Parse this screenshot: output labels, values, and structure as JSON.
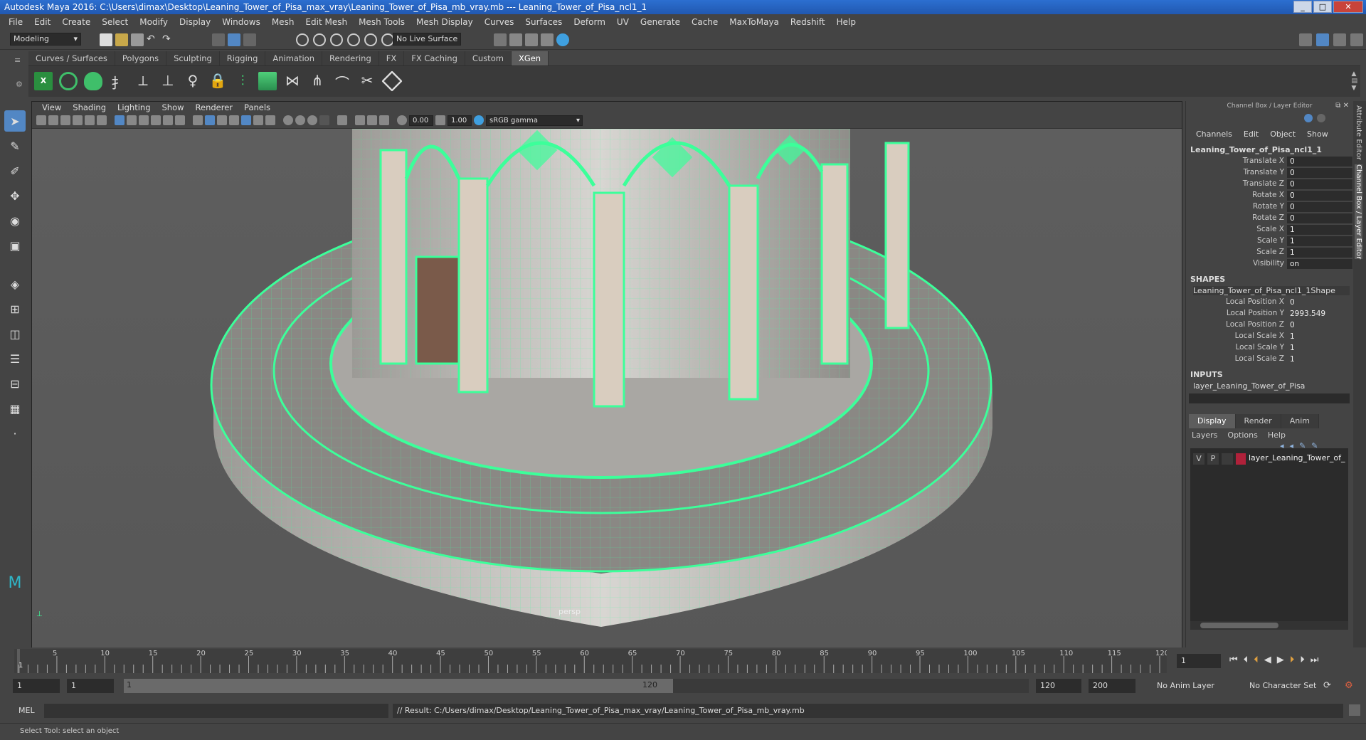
{
  "title": "Autodesk Maya 2016: C:\\Users\\dimax\\Desktop\\Leaning_Tower_of_Pisa_max_vray\\Leaning_Tower_of_Pisa_mb_vray.mb   ---   Leaning_Tower_of_Pisa_ncl1_1",
  "menubar": [
    "File",
    "Edit",
    "Create",
    "Select",
    "Modify",
    "Display",
    "Windows",
    "Mesh",
    "Edit Mesh",
    "Mesh Tools",
    "Mesh Display",
    "Curves",
    "Surfaces",
    "Deform",
    "UV",
    "Generate",
    "Cache",
    "MaxToMaya",
    "Redshift",
    "Help"
  ],
  "status": {
    "menuset": "Modeling",
    "live_surface": "No Live Surface"
  },
  "shelf_tabs": [
    "Curves / Surfaces",
    "Polygons",
    "Sculpting",
    "Rigging",
    "Animation",
    "Rendering",
    "FX",
    "FX Caching",
    "Custom",
    "XGen"
  ],
  "active_shelf": "XGen",
  "viewport": {
    "menu": [
      "View",
      "Shading",
      "Lighting",
      "Show",
      "Renderer",
      "Panels"
    ],
    "exposure": "0.00",
    "gamma": "1.00",
    "color_space": "sRGB gamma",
    "camera_label": "persp"
  },
  "channelbox": {
    "title": "Channel Box / Layer Editor",
    "menu": [
      "Channels",
      "Edit",
      "Object",
      "Show"
    ],
    "object": "Leaning_Tower_of_Pisa_ncl1_1",
    "attrs": [
      {
        "label": "Translate X",
        "value": "0"
      },
      {
        "label": "Translate Y",
        "value": "0"
      },
      {
        "label": "Translate Z",
        "value": "0"
      },
      {
        "label": "Rotate X",
        "value": "0"
      },
      {
        "label": "Rotate Y",
        "value": "0"
      },
      {
        "label": "Rotate Z",
        "value": "0"
      },
      {
        "label": "Scale X",
        "value": "1"
      },
      {
        "label": "Scale Y",
        "value": "1"
      },
      {
        "label": "Scale Z",
        "value": "1"
      },
      {
        "label": "Visibility",
        "value": "on"
      }
    ],
    "shapes_header": "SHAPES",
    "shape_name": "Leaning_Tower_of_Pisa_ncl1_1Shape",
    "shape_attrs": [
      {
        "label": "Local Position X",
        "value": "0"
      },
      {
        "label": "Local Position Y",
        "value": "2993.549"
      },
      {
        "label": "Local Position Z",
        "value": "0"
      },
      {
        "label": "Local Scale X",
        "value": "1"
      },
      {
        "label": "Local Scale Y",
        "value": "1"
      },
      {
        "label": "Local Scale Z",
        "value": "1"
      }
    ],
    "inputs_header": "INPUTS",
    "input_name": "layer_Leaning_Tower_of_Pisa",
    "layer_tabs": [
      "Display",
      "Render",
      "Anim"
    ],
    "layer_menu": [
      "Layers",
      "Options",
      "Help"
    ],
    "layer": {
      "v": "V",
      "p": "P",
      "name": "layer_Leaning_Tower_of_",
      "color": "#b0213a"
    }
  },
  "side_tabs": [
    "Attribute Editor",
    "Channel Box / Layer Editor"
  ],
  "timeline": {
    "ticks": [
      "5",
      "10",
      "15",
      "20",
      "25",
      "30",
      "35",
      "40",
      "45",
      "50",
      "55",
      "60",
      "65",
      "70",
      "75",
      "80",
      "85",
      "90",
      "95",
      "100",
      "105",
      "110",
      "115",
      "120"
    ],
    "current_frame": "1",
    "frame_field": "1"
  },
  "range": {
    "start": "1",
    "start2": "1",
    "slider_start": "1",
    "slider_end": "120",
    "end": "120",
    "end2": "200",
    "anim_layer": "No Anim Layer",
    "char_set": "No Character Set"
  },
  "cmdline": {
    "label": "MEL",
    "result": "// Result: C:/Users/dimax/Desktop/Leaning_Tower_of_Pisa_max_vray/Leaning_Tower_of_Pisa_mb_vray.mb"
  },
  "helpline": "Select Tool: select an object",
  "colors": {
    "wire": "#3cff9a",
    "accent": "#5287c4"
  }
}
